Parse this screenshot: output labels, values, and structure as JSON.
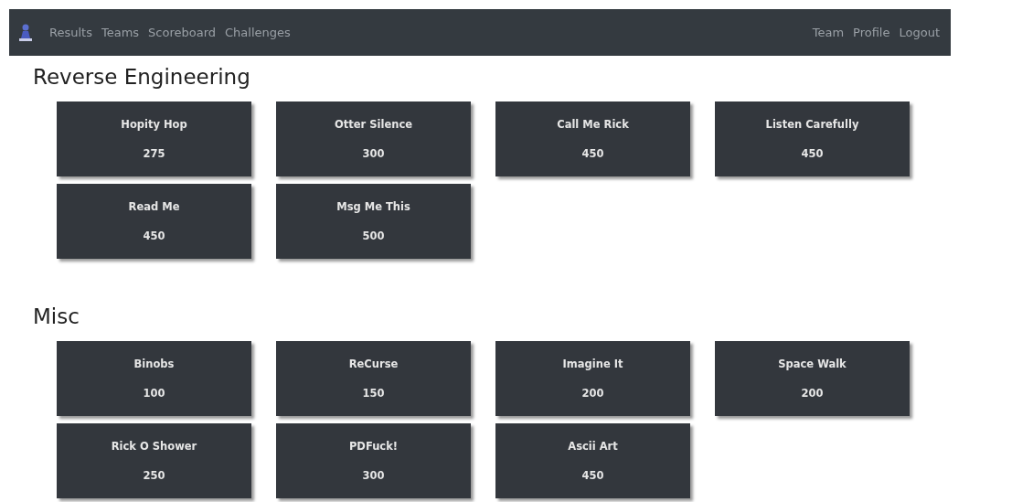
{
  "nav": {
    "left": [
      "Results",
      "Teams",
      "Scoreboard",
      "Challenges"
    ],
    "right": [
      "Team",
      "Profile",
      "Logout"
    ]
  },
  "categories": [
    {
      "title": "Reverse Engineering",
      "challenges": [
        {
          "name": "Hopity Hop",
          "points": "275"
        },
        {
          "name": "Otter Silence",
          "points": "300"
        },
        {
          "name": "Call Me Rick",
          "points": "450"
        },
        {
          "name": "Listen Carefully",
          "points": "450"
        },
        {
          "name": "Read Me",
          "points": "450"
        },
        {
          "name": "Msg Me This",
          "points": "500"
        }
      ]
    },
    {
      "title": "Misc",
      "challenges": [
        {
          "name": "Binobs",
          "points": "100"
        },
        {
          "name": "ReCurse",
          "points": "150"
        },
        {
          "name": "Imagine It",
          "points": "200"
        },
        {
          "name": "Space Walk",
          "points": "200"
        },
        {
          "name": "Rick O Shower",
          "points": "250"
        },
        {
          "name": "PDFuck!",
          "points": "300"
        },
        {
          "name": "Ascii Art",
          "points": "450"
        }
      ]
    }
  ]
}
